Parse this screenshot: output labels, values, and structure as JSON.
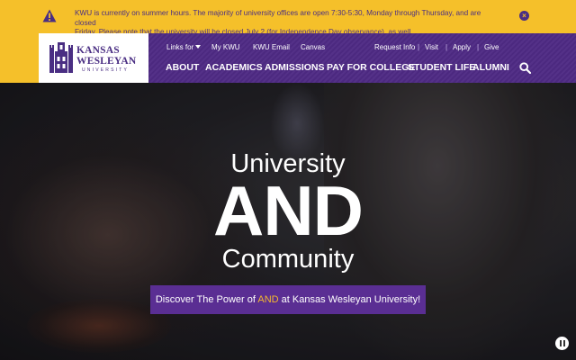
{
  "alert": {
    "text_line1": "KWU is currently on summer hours. The majority of university offices are open 7:30-5:30, Monday through Thursday, and are closed",
    "text_line2": "Friday. Please note that the university will be closed July 2 (for Independence Day observance), as well.",
    "close_label": "×",
    "icon": "warning-icon"
  },
  "logo": {
    "line1": "KANSAS",
    "line2": "WESLEYAN",
    "line3": "UNIVERSITY"
  },
  "utility_nav": {
    "links_for": "Links for",
    "my_kwu": "My KWU",
    "kwu_email": "KWU Email",
    "canvas": "Canvas",
    "request_info": "Request Info",
    "visit": "Visit",
    "apply": "Apply",
    "give": "Give",
    "separator": "|"
  },
  "main_nav": {
    "about": "ABOUT",
    "academics": "ACADEMICS",
    "admissions": "ADMISSIONS",
    "pay": "PAY FOR COLLEGE",
    "student_life": "STUDENT LIFE",
    "alumni": "ALUMNI"
  },
  "hero": {
    "line1": "University",
    "line2": "AND",
    "line3": "Community",
    "cta_before": "Discover The Power of ",
    "cta_accent": "AND",
    "cta_after": " at Kansas Wesleyan University!"
  },
  "colors": {
    "brand_purple": "#4e2a84",
    "brand_gold": "#f5c02a",
    "cta_purple": "#5a2e93",
    "accent_gold": "#f5b82e"
  }
}
